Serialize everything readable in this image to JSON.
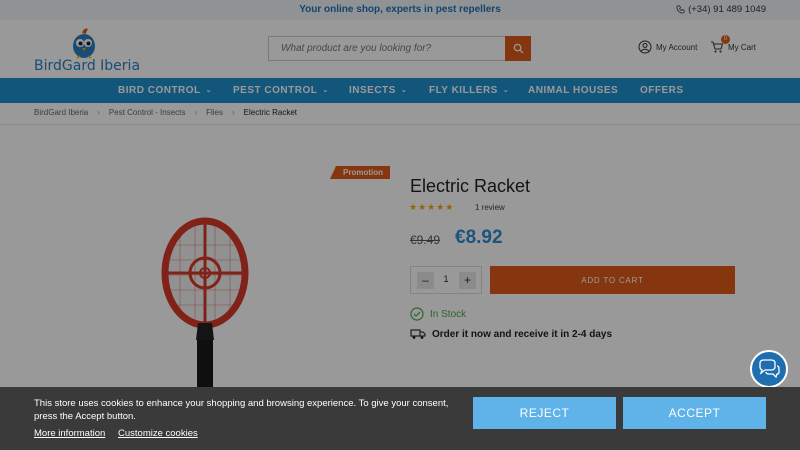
{
  "topbar": {
    "tagline": "Your online shop, experts in pest repellers",
    "phone": "(+34) 91 489 1049"
  },
  "header": {
    "brand": "BirdGard Iberia",
    "search_placeholder": "What product are you looking for?",
    "account_label": "My Account",
    "cart_label": "My Cart",
    "cart_count": "0"
  },
  "nav": {
    "items": [
      {
        "label": "BIRD CONTROL",
        "caret": "⌄"
      },
      {
        "label": "PEST CONTROL",
        "caret": "⌄"
      },
      {
        "label": "INSECTS",
        "caret": "⌄"
      },
      {
        "label": "FLY KILLERS",
        "caret": "⌄"
      },
      {
        "label": "ANIMAL HOUSES"
      },
      {
        "label": "OFFERS"
      }
    ]
  },
  "breadcrumb": {
    "items": [
      "BirdGard Iberia",
      "Pest Control - Insects",
      "Flies"
    ],
    "current": "Electric Racket",
    "sep": "›"
  },
  "product": {
    "badge": "Promotion",
    "title": "Electric Racket",
    "stars": "★★★★★",
    "reviews": "1 review",
    "old_price": "€9.49",
    "new_price": "€8.92",
    "quantity": "1",
    "minus": "–",
    "plus": "+",
    "add_to_cart": "ADD TO CART",
    "stock": "In Stock",
    "delivery": "Order it now and receive it in 2-4 days"
  },
  "cookie": {
    "message": "This store uses cookies to enhance your shopping and browsing experience. To give your consent, press the Accept button.",
    "more_info": "More information",
    "customize": "Customize cookies",
    "reject": "REJECT",
    "accept": "ACCEPT"
  },
  "colors": {
    "accent": "#e05a1a",
    "nav": "#1f8fcf",
    "price": "#2a8fd0",
    "cookie_btn": "#5fb3e8"
  },
  "icons": [
    "phone-icon",
    "bird-logo-icon",
    "search-icon",
    "user-icon",
    "cart-icon",
    "check-circle-icon",
    "truck-icon",
    "chat-icon"
  ]
}
